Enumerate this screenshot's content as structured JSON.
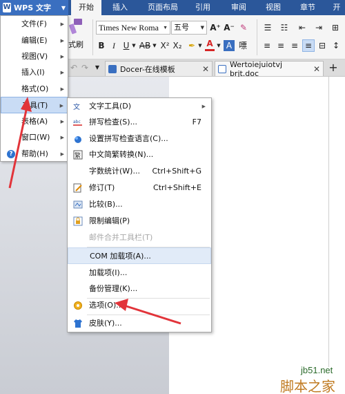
{
  "app": {
    "menu_button": "WPS 文字"
  },
  "ribbon_tabs": [
    "开始",
    "插入",
    "页面布局",
    "引用",
    "审阅",
    "视图",
    "章节",
    "开"
  ],
  "toolbar": {
    "format_painter": "式刷",
    "font_name": "Times New Roma",
    "font_size": "五号",
    "bold": "B",
    "italic": "I",
    "underline": "U",
    "strike": "AB",
    "superscript": "X²",
    "subscript": "X₂",
    "grow_font": "A⁺",
    "shrink_font": "A⁻",
    "font_color": "A"
  },
  "doc_tabs": [
    {
      "label": "Docer-在线模板"
    },
    {
      "label": "Wertoiejuiotvj brjt.doc"
    }
  ],
  "main_menu": [
    {
      "label": "文件(F)"
    },
    {
      "label": "编辑(E)"
    },
    {
      "label": "视图(V)"
    },
    {
      "label": "插入(I)"
    },
    {
      "label": "格式(O)"
    },
    {
      "label": "工具(T)"
    },
    {
      "label": "表格(A)"
    },
    {
      "label": "窗口(W)"
    },
    {
      "label": "帮助(H)"
    }
  ],
  "tools_submenu": [
    {
      "label": "文字工具(D)",
      "shortcut": "",
      "icon": "text-tool-icon"
    },
    {
      "label": "拼写检查(S)...",
      "shortcut": "F7",
      "icon": "spell-check-icon"
    },
    {
      "label": "设置拼写检查语言(C)...",
      "shortcut": "",
      "icon": "language-globe-icon"
    },
    {
      "label": "中文简繁转换(N)...",
      "shortcut": "",
      "icon": "chinese-convert-icon"
    },
    {
      "label": "字数统计(W)...",
      "shortcut": "Ctrl+Shift+G",
      "icon": ""
    },
    {
      "label": "修订(T)",
      "shortcut": "Ctrl+Shift+E",
      "icon": "revision-icon"
    },
    {
      "label": "比较(B)...",
      "shortcut": "",
      "icon": "compare-icon"
    },
    {
      "label": "限制编辑(P)",
      "shortcut": "",
      "icon": "lock-icon"
    },
    {
      "label": "邮件合并工具栏(T)",
      "shortcut": "",
      "icon": ""
    },
    {
      "label": "COM 加载项(A)...",
      "shortcut": "",
      "icon": ""
    },
    {
      "label": "加载项(I)...",
      "shortcut": "",
      "icon": ""
    },
    {
      "label": "备份管理(K)...",
      "shortcut": "",
      "icon": ""
    },
    {
      "label": "选项(O)...",
      "shortcut": "",
      "icon": "gear-icon"
    },
    {
      "label": "皮肤(Y)...",
      "shortcut": "",
      "icon": "shirt-icon"
    }
  ],
  "watermark": {
    "url": "jb51.net",
    "text": "脚本之家"
  },
  "colors": {
    "ribbon": "#2b579a",
    "highlight": "#c9dcf5",
    "arrow": "#e2343a"
  }
}
